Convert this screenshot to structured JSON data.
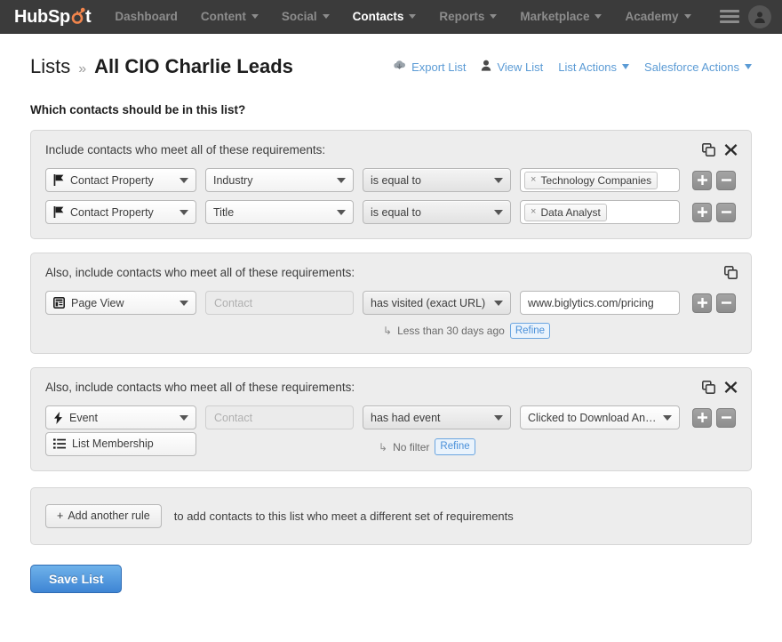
{
  "nav": {
    "logo": {
      "hub": "Hub",
      "sp": "Sp",
      "t": "t",
      "icon": "hubspot-sprocket-icon"
    },
    "items": [
      {
        "label": "Dashboard",
        "caret": false,
        "active": false
      },
      {
        "label": "Content",
        "caret": true,
        "active": false
      },
      {
        "label": "Social",
        "caret": true,
        "active": false
      },
      {
        "label": "Contacts",
        "caret": true,
        "active": true
      },
      {
        "label": "Reports",
        "caret": true,
        "active": false
      },
      {
        "label": "Marketplace",
        "caret": true,
        "active": false
      },
      {
        "label": "Academy",
        "caret": true,
        "active": false
      }
    ],
    "menu_icon": "hamburger-icon",
    "avatar_icon": "user-avatar-icon"
  },
  "breadcrumb": {
    "parent": "Lists",
    "separator": "»",
    "current": "All CIO Charlie Leads"
  },
  "actions": [
    {
      "label": "Export List",
      "icon": "cloud-download-icon",
      "caret": false
    },
    {
      "label": "View List",
      "icon": "person-icon",
      "caret": false
    },
    {
      "label": "List Actions",
      "icon": null,
      "caret": true
    },
    {
      "label": "Salesforce Actions",
      "icon": null,
      "caret": true
    }
  ],
  "question": "Which contacts should be in this list?",
  "groups": [
    {
      "title": "Include contacts who meet all of these requirements:",
      "has_copy": true,
      "has_close": true,
      "rules": [
        {
          "type": "Contact Property",
          "type_icon": "flag-icon",
          "property": "Industry",
          "property_disabled": false,
          "operator": "is equal to",
          "value_kind": "token",
          "value": "Technology Companies",
          "token_close": "×",
          "add_label": "+",
          "remove_label": "−"
        },
        {
          "type": "Contact Property",
          "type_icon": "flag-icon",
          "property": "Title",
          "property_disabled": false,
          "operator": "is equal to",
          "value_kind": "token",
          "value": "Data Analyst",
          "token_close": "×",
          "add_label": "+",
          "remove_label": "−"
        }
      ],
      "refine": null,
      "extra_button": null
    },
    {
      "title": "Also, include contacts who meet all of these requirements:",
      "has_copy": true,
      "has_close": false,
      "rules": [
        {
          "type": "Page View",
          "type_icon": "page-icon",
          "property": "Contact",
          "property_disabled": true,
          "operator": "has visited (exact URL)",
          "value_kind": "text",
          "value": "www.biglytics.com/pricing",
          "add_label": "+",
          "remove_label": "−"
        }
      ],
      "refine": {
        "hook": "↳",
        "text": "Less than 30 days ago",
        "badge": "Refine"
      },
      "extra_button": null
    },
    {
      "title": "Also, include contacts who meet all of these requirements:",
      "has_copy": true,
      "has_close": true,
      "rules": [
        {
          "type": "Event",
          "type_icon": "lightning-icon",
          "property": "Contact",
          "property_disabled": true,
          "operator": "has had event",
          "value_kind": "select",
          "value": "Clicked to Download An Intr...",
          "add_label": "+",
          "remove_label": "−"
        }
      ],
      "refine": {
        "hook": "↳",
        "text": "No filter",
        "badge": "Refine"
      },
      "extra_button": {
        "label": "List Membership",
        "icon": "list-icon"
      }
    }
  ],
  "add_rule": {
    "button_label": "Add another rule",
    "button_plus": "+",
    "description": "to add contacts to this list who meet a different set of requirements"
  },
  "save_button": "Save List",
  "colors": {
    "nav_bg": "#3b3b3b",
    "link_blue": "#5b9bd5",
    "accent_orange": "#f2854c",
    "group_bg": "#ededed",
    "save_blue": "#3e85d4"
  }
}
